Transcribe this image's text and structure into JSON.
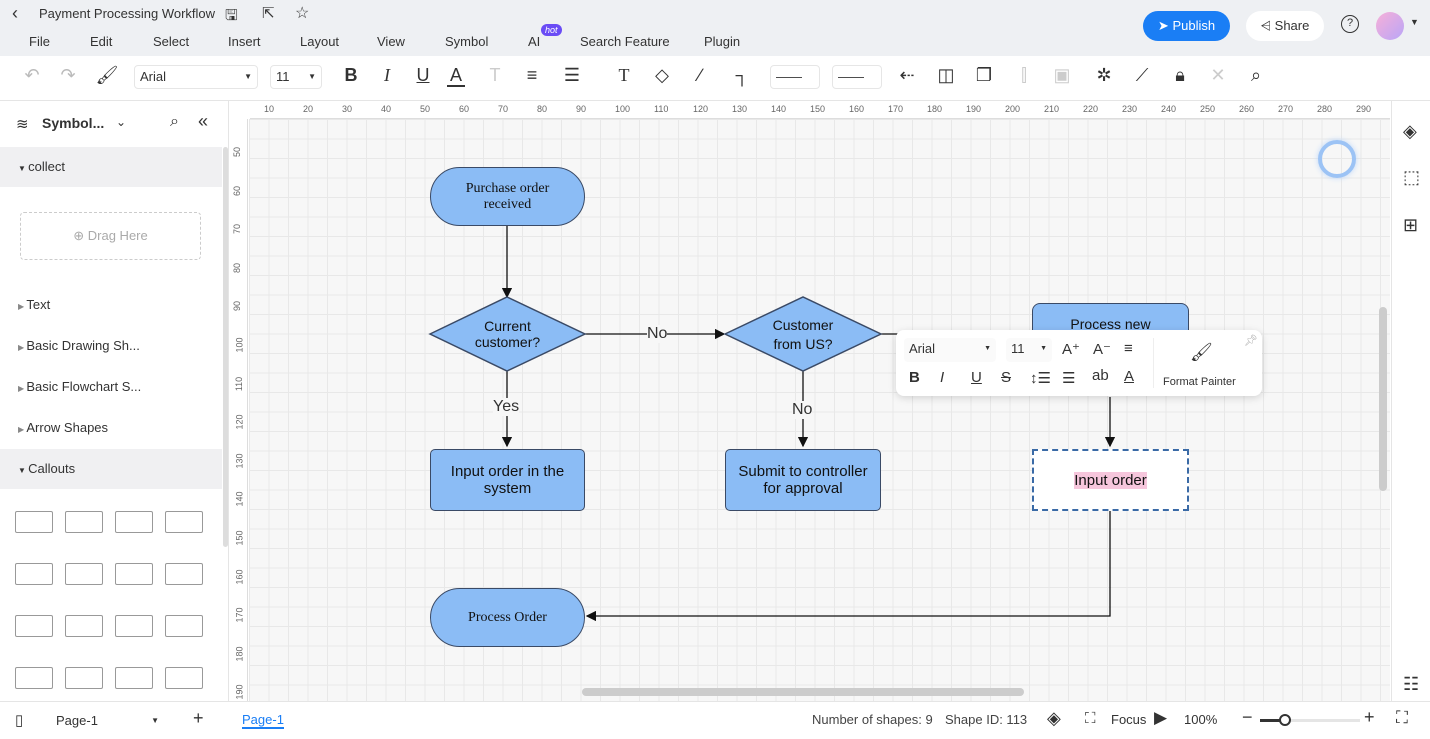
{
  "document": {
    "title": "Payment Processing Workflow"
  },
  "menu": [
    "File",
    "Edit",
    "Select",
    "Insert",
    "Layout",
    "View",
    "Symbol",
    "AI",
    "Search Feature",
    "Plugin"
  ],
  "menu_badge": "hot",
  "header": {
    "publish": "Publish",
    "share": "Share"
  },
  "toolbar": {
    "font": "Arial",
    "size": "11"
  },
  "left_panel": {
    "title": "Symbol...",
    "sections": [
      {
        "label": "collect",
        "expanded": true
      },
      {
        "label": "Text"
      },
      {
        "label": "Basic Drawing Sh..."
      },
      {
        "label": "Basic Flowchart S..."
      },
      {
        "label": "Arrow Shapes"
      },
      {
        "label": "Callouts",
        "expanded": true
      }
    ],
    "drag_here": "Drag Here"
  },
  "ruler": {
    "top": [
      "10",
      "20",
      "30",
      "40",
      "50",
      "60",
      "70",
      "80",
      "90",
      "100",
      "110",
      "120",
      "130",
      "140",
      "150",
      "160",
      "170",
      "180",
      "190",
      "200",
      "210",
      "220",
      "230",
      "240",
      "250",
      "260",
      "270",
      "280",
      "290"
    ],
    "left": [
      "50",
      "60",
      "70",
      "80",
      "90",
      "100",
      "110",
      "120",
      "130",
      "140",
      "150",
      "160",
      "170",
      "180",
      "190"
    ]
  },
  "diagram": {
    "start": "Purchase  order received",
    "d1": "Current customer?",
    "d2": "Customer from US?",
    "p_new": "Process new",
    "input_system": "Input order in the system",
    "controller": "Submit to controller for approval",
    "input_order": "Input order",
    "process_order": "Process Order",
    "labels": {
      "no1": "No",
      "yes": "Yes",
      "no2": "No"
    }
  },
  "floating_toolbar": {
    "font": "Arial",
    "size": "11",
    "format_painter": "Format Painter"
  },
  "status": {
    "page_select": "Page-1",
    "page_tab": "Page-1",
    "shapes": "Number of shapes: 9",
    "shape_id": "Shape ID: 113",
    "focus": "Focus",
    "zoom": "100%",
    "zoom_level": 100
  },
  "colors": {
    "accent": "#1a7ef5",
    "shape_fill": "#8bbcf5",
    "highlight": "#f6c6dc"
  }
}
